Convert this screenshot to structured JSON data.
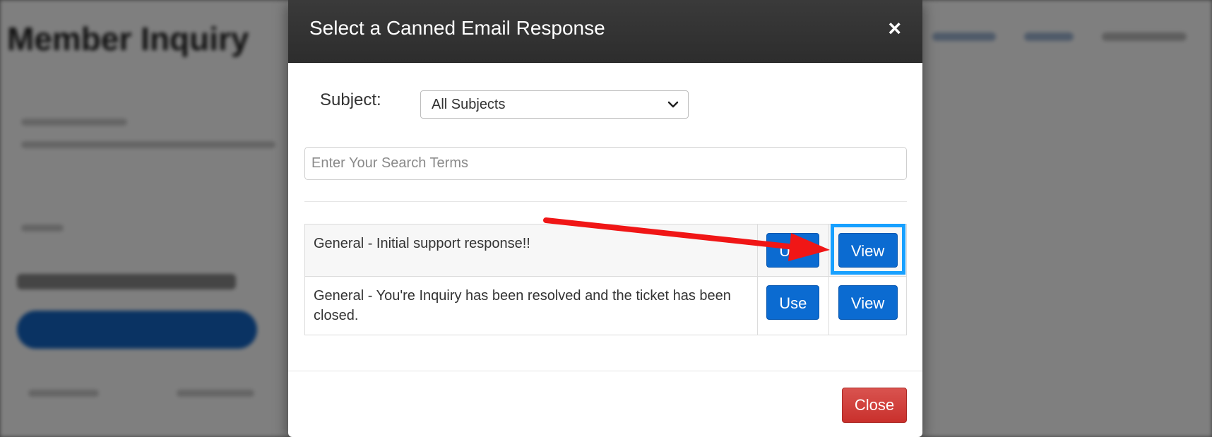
{
  "modal": {
    "title": "Select a Canned Email Response",
    "close_x": "×",
    "subject_label": "Subject:",
    "subject_selected": "All Subjects",
    "search_placeholder": "Enter Your Search Terms",
    "rows": [
      {
        "name": "General - Initial support response!!",
        "use_label": "Use",
        "view_label": "View"
      },
      {
        "name": "General - You're Inquiry has been resolved and the ticket has been closed.",
        "use_label": "Use",
        "view_label": "View"
      }
    ],
    "close_button": "Close"
  },
  "colors": {
    "header_bg": "#333333",
    "primary_button": "#0b6bd1",
    "danger_button": "#d9534f",
    "highlight": "#17a0ff",
    "annotation_arrow": "#f01616"
  },
  "icons": {
    "close": "close-icon",
    "dropdown": "chevron-down-icon"
  }
}
